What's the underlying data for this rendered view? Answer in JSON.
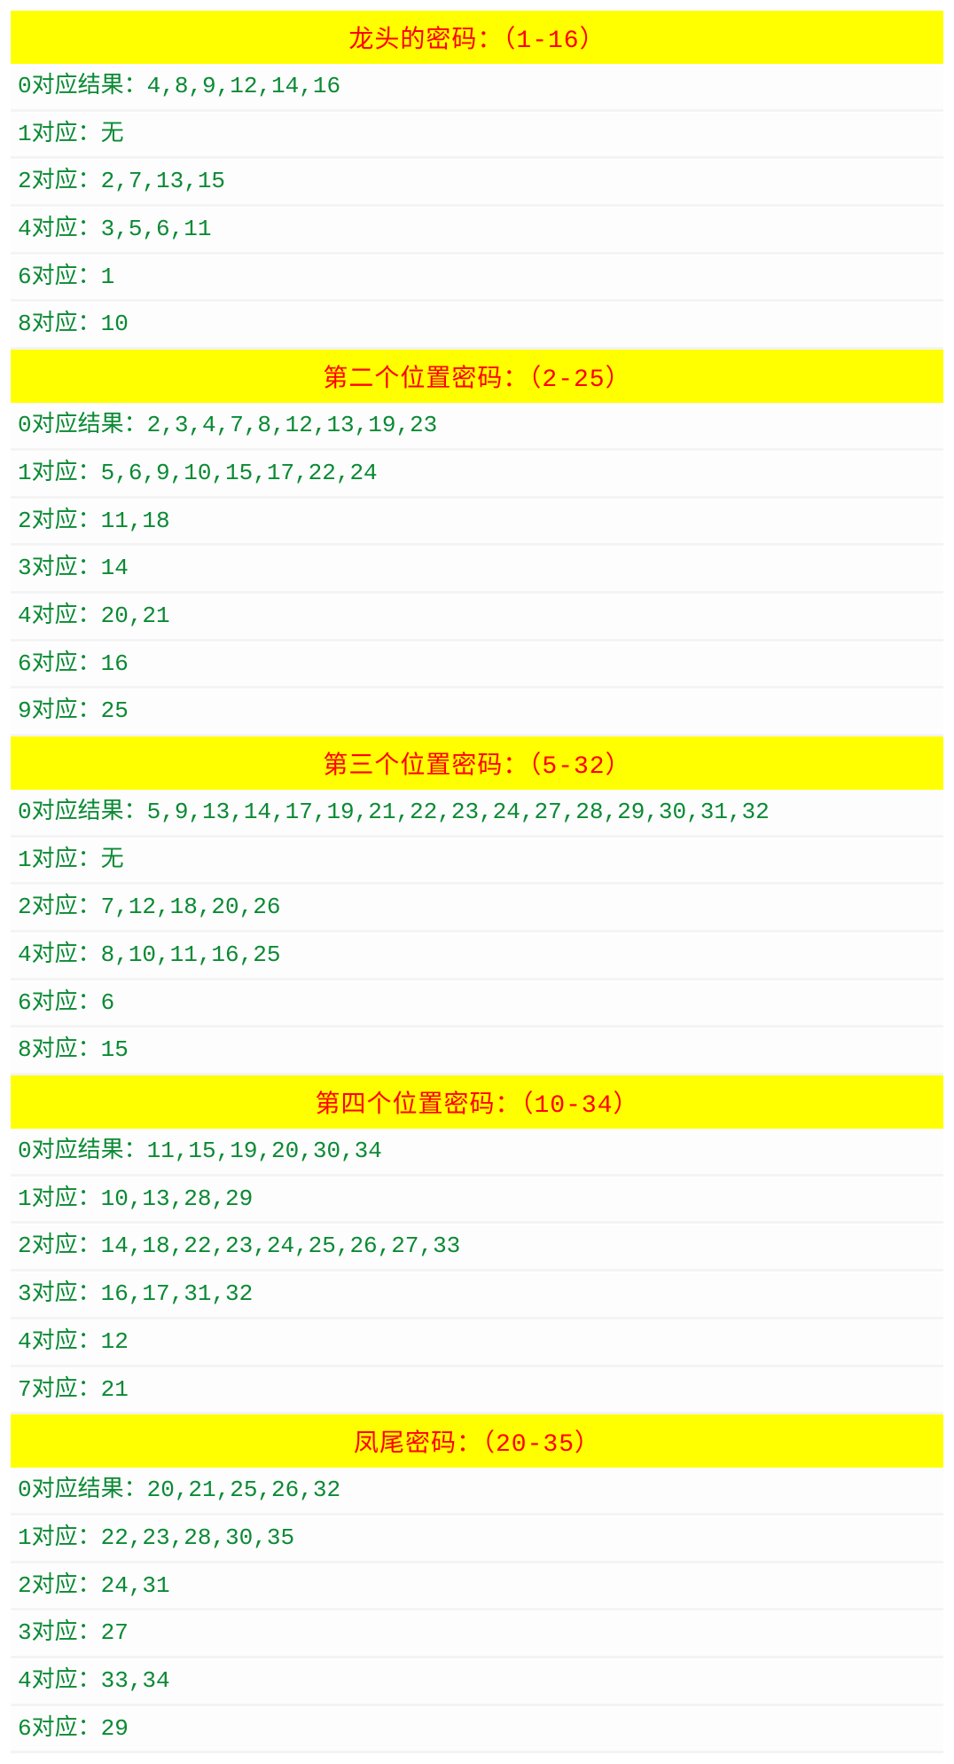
{
  "sections": [
    {
      "title": "龙头的密码：（1-16）",
      "rows": [
        {
          "key": "0对应结果：",
          "val": "4,8,9,12,14,16"
        },
        {
          "key": "1对应：",
          "val": "无"
        },
        {
          "key": "2对应：",
          "val": "2,7,13,15"
        },
        {
          "key": "4对应：",
          "val": "3,5,6,11"
        },
        {
          "key": "6对应：",
          "val": "1"
        },
        {
          "key": "8对应：",
          "val": "10"
        }
      ]
    },
    {
      "title": "第二个位置密码：（2-25）",
      "rows": [
        {
          "key": "0对应结果：",
          "val": "2,3,4,7,8,12,13,19,23"
        },
        {
          "key": "1对应：",
          "val": "5,6,9,10,15,17,22,24"
        },
        {
          "key": "2对应：",
          "val": "11,18"
        },
        {
          "key": "3对应：",
          "val": "14"
        },
        {
          "key": "4对应：",
          "val": "20,21"
        },
        {
          "key": "6对应：",
          "val": "16"
        },
        {
          "key": "9对应：",
          "val": "25"
        }
      ]
    },
    {
      "title": "第三个位置密码：（5-32）",
      "rows": [
        {
          "key": "0对应结果：",
          "val": "5,9,13,14,17,19,21,22,23,24,27,28,29,30,31,32"
        },
        {
          "key": "1对应：",
          "val": "无"
        },
        {
          "key": "2对应：",
          "val": "7,12,18,20,26"
        },
        {
          "key": "4对应：",
          "val": "8,10,11,16,25"
        },
        {
          "key": "6对应：",
          "val": "6"
        },
        {
          "key": "8对应：",
          "val": "15"
        }
      ]
    },
    {
      "title": "第四个位置密码：（10-34）",
      "rows": [
        {
          "key": "0对应结果：",
          "val": "11,15,19,20,30,34"
        },
        {
          "key": "1对应：",
          "val": "10,13,28,29"
        },
        {
          "key": "2对应：",
          "val": "14,18,22,23,24,25,26,27,33"
        },
        {
          "key": "3对应：",
          "val": "16,17,31,32"
        },
        {
          "key": "4对应：",
          "val": "12"
        },
        {
          "key": "7对应：",
          "val": "21"
        }
      ]
    },
    {
      "title": "凤尾密码：（20-35）",
      "rows": [
        {
          "key": "0对应结果：",
          "val": "20,21,25,26,32"
        },
        {
          "key": "1对应：",
          "val": "22,23,28,30,35"
        },
        {
          "key": "2对应：",
          "val": "24,31"
        },
        {
          "key": "3对应：",
          "val": "27"
        },
        {
          "key": "4对应：",
          "val": "33,34"
        },
        {
          "key": "6对应：",
          "val": "29"
        }
      ]
    }
  ]
}
